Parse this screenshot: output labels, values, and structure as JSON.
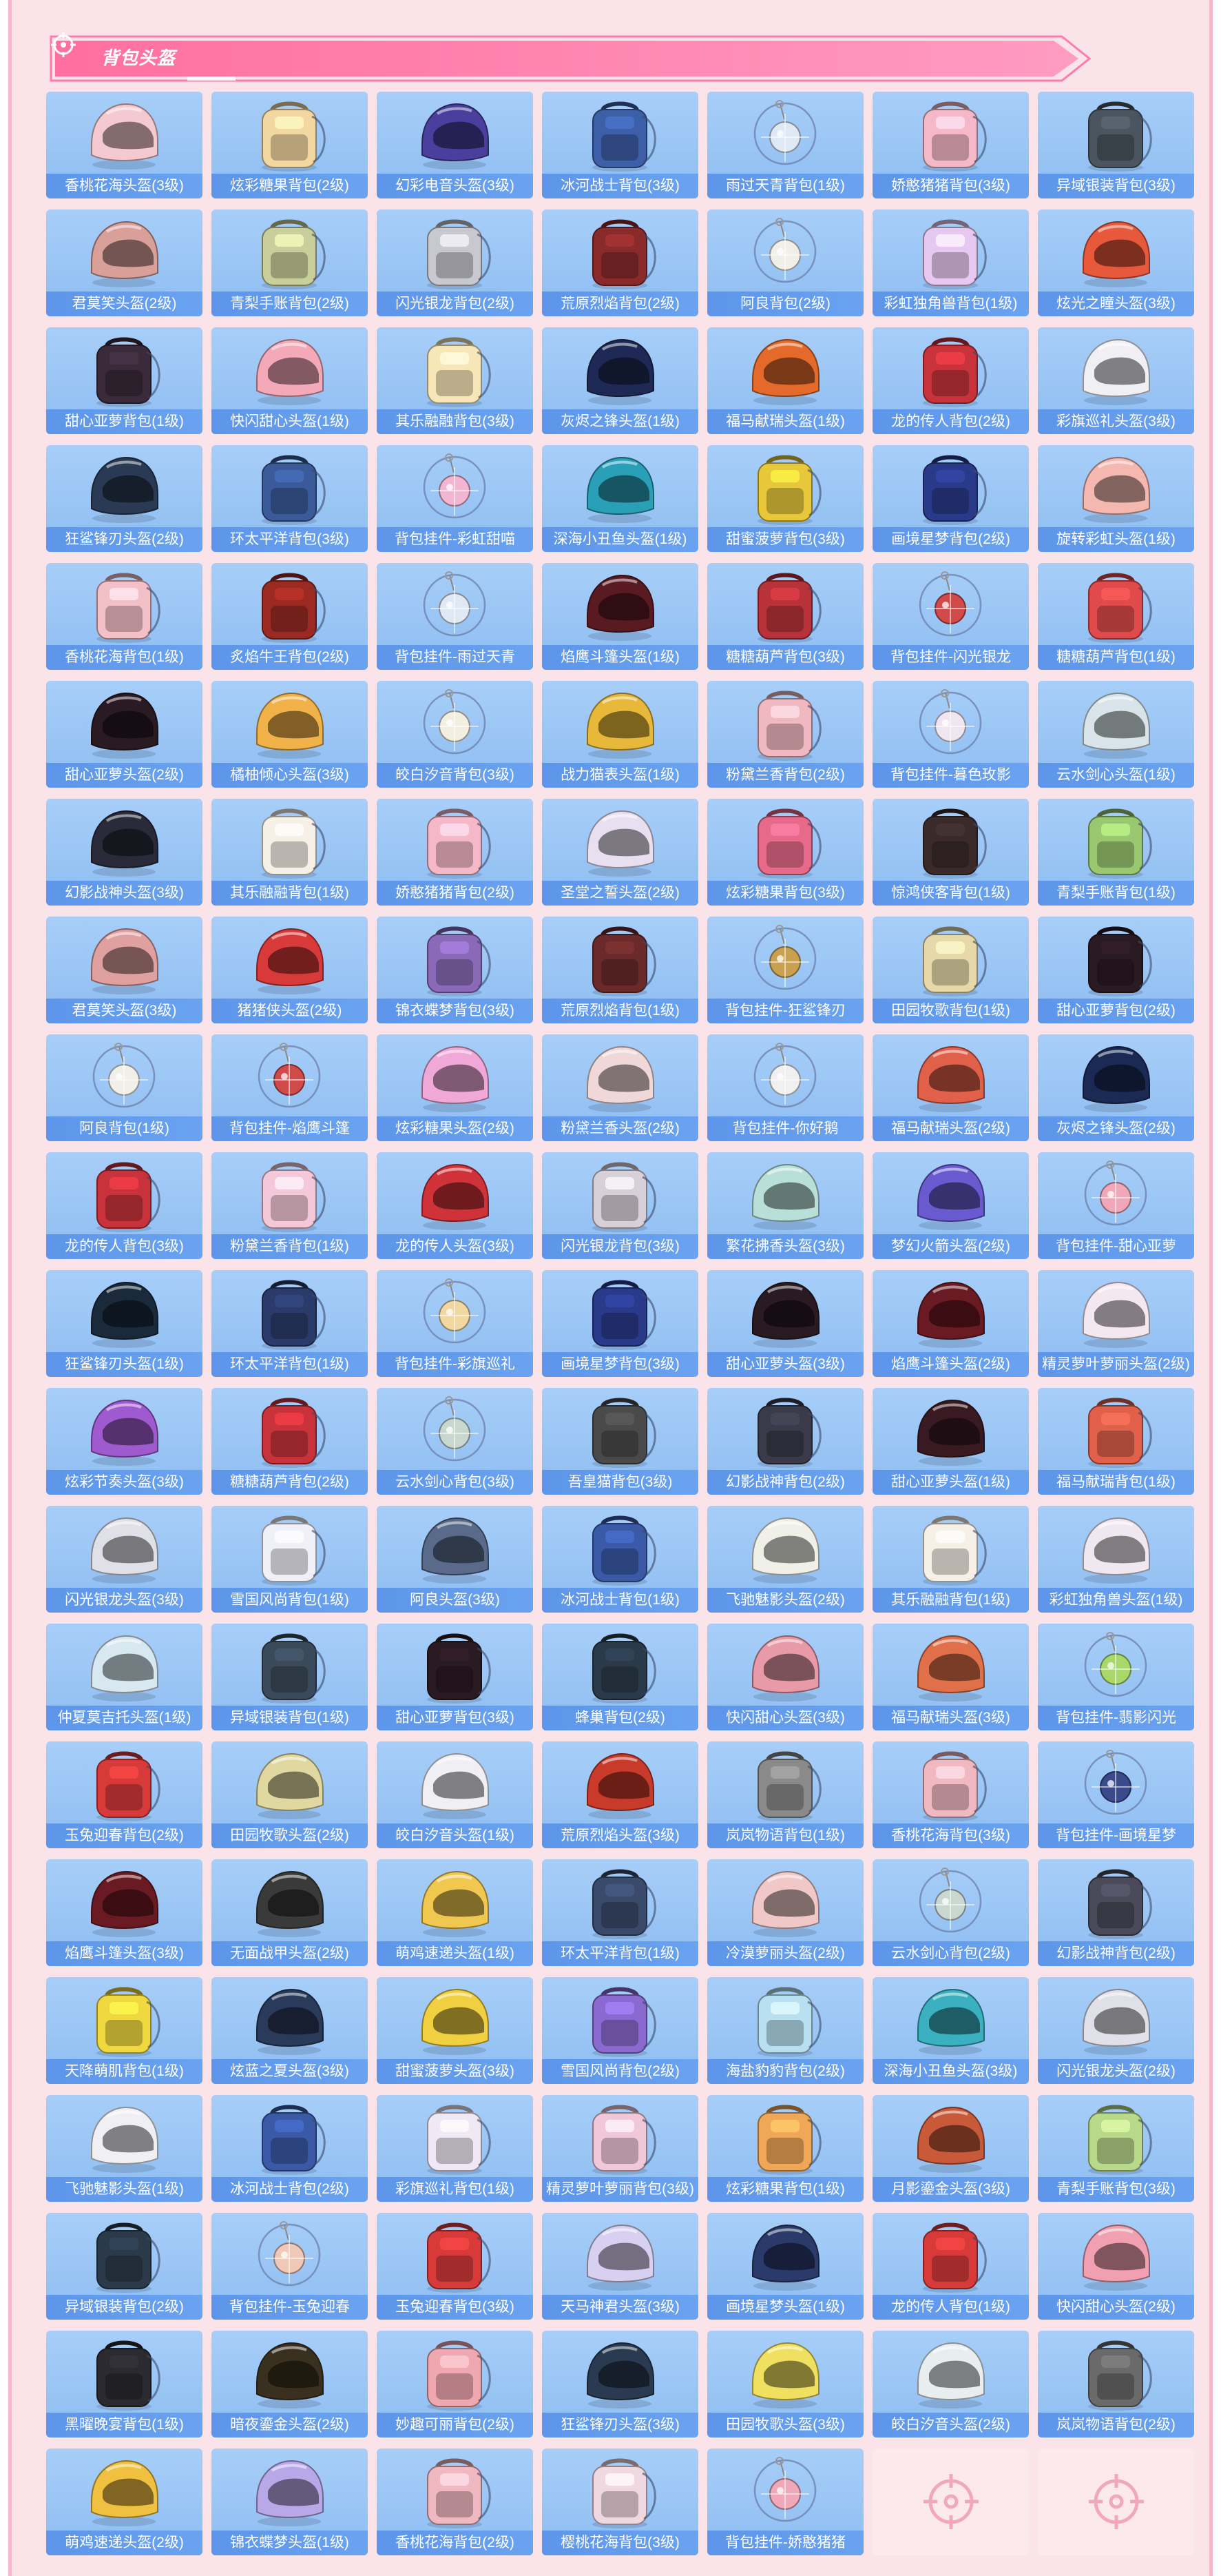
{
  "section": {
    "title": "背包头盔",
    "icon": "target-icon"
  },
  "colors": {
    "accent": "#ff7aa8",
    "tile_bg": "#9ac5f5",
    "label_bg": "#5d95ea",
    "empty_tile": "#fbe9ee",
    "panel_bg": "#fbe3ea"
  },
  "items": [
    {
      "label": "香桃花海头盔(3级)",
      "kind": "helmet",
      "color": "#f4c9cf"
    },
    {
      "label": "炫彩糖果背包(2级)",
      "kind": "backpack",
      "color": "#f2d7a0"
    },
    {
      "label": "幻彩电音头盔(3级)",
      "kind": "helmet",
      "color": "#4a3f9c"
    },
    {
      "label": "冰河战士背包(3级)",
      "kind": "backpack",
      "color": "#3d5fa8"
    },
    {
      "label": "雨过天青背包(1级)",
      "kind": "charm",
      "color": "#dfe8f5"
    },
    {
      "label": "娇憨猪猪背包(3级)",
      "kind": "backpack",
      "color": "#f4b8c8"
    },
    {
      "label": "异域银装背包(3级)",
      "kind": "backpack",
      "color": "#4b5560"
    },
    {
      "label": "君莫笑头盔(2级)",
      "kind": "helmet",
      "color": "#d9a09a"
    },
    {
      "label": "青梨手账背包(2级)",
      "kind": "backpack",
      "color": "#c9cf9a"
    },
    {
      "label": "闪光银龙背包(2级)",
      "kind": "backpack",
      "color": "#c8c8d0"
    },
    {
      "label": "荒原烈焰背包(2级)",
      "kind": "backpack",
      "color": "#8a2a2a"
    },
    {
      "label": "阿良背包(2级)",
      "kind": "charm",
      "color": "#f0efe8"
    },
    {
      "label": "彩虹独角兽背包(1级)",
      "kind": "backpack",
      "color": "#e6c8f0"
    },
    {
      "label": "炫光之瞳头盔(3级)",
      "kind": "helmet",
      "color": "#e8583a"
    },
    {
      "label": "甜心亚萝背包(1级)",
      "kind": "backpack",
      "color": "#3b2a3a"
    },
    {
      "label": "快闪甜心头盔(1级)",
      "kind": "helmet",
      "color": "#f4a9b8"
    },
    {
      "label": "其乐融融背包(3级)",
      "kind": "backpack",
      "color": "#f6e6b8"
    },
    {
      "label": "灰烬之锋头盔(1级)",
      "kind": "helmet",
      "color": "#1e2a55"
    },
    {
      "label": "福马献瑞头盔(1级)",
      "kind": "helmet",
      "color": "#e36a2a"
    },
    {
      "label": "龙的传人背包(2级)",
      "kind": "backpack",
      "color": "#c8323a"
    },
    {
      "label": "彩旗巡礼头盔(3级)",
      "kind": "helmet",
      "color": "#f0f0f4"
    },
    {
      "label": "狂鲨锋刃头盔(2级)",
      "kind": "helmet",
      "color": "#2a3a55"
    },
    {
      "label": "环太平洋背包(3级)",
      "kind": "backpack",
      "color": "#3a5a9a"
    },
    {
      "label": "背包挂件-彩虹甜喵",
      "kind": "charm",
      "color": "#f3b6d2"
    },
    {
      "label": "深海小丑鱼头盔(1级)",
      "kind": "helmet",
      "color": "#2aa0b8"
    },
    {
      "label": "甜蜜菠萝背包(3级)",
      "kind": "backpack",
      "color": "#e6c83a"
    },
    {
      "label": "画境星梦背包(2级)",
      "kind": "backpack",
      "color": "#2a3a8a"
    },
    {
      "label": "旋转彩虹头盔(1级)",
      "kind": "helmet",
      "color": "#f4b8b0"
    },
    {
      "label": "香桃花海背包(1级)",
      "kind": "backpack",
      "color": "#f4c0c8"
    },
    {
      "label": "炙焰牛王背包(2级)",
      "kind": "backpack",
      "color": "#9a2a22"
    },
    {
      "label": "背包挂件-雨过天青",
      "kind": "charm",
      "color": "#e0e8f4"
    },
    {
      "label": "焰鹰斗篷头盔(1级)",
      "kind": "helmet",
      "color": "#5a1a22"
    },
    {
      "label": "糖糖葫芦背包(3级)",
      "kind": "backpack",
      "color": "#b8323a"
    },
    {
      "label": "背包挂件-闪光银龙",
      "kind": "charm",
      "color": "#d04a4a"
    },
    {
      "label": "糖糖葫芦背包(1级)",
      "kind": "backpack",
      "color": "#e04a4a"
    },
    {
      "label": "甜心亚萝头盔(2级)",
      "kind": "helmet",
      "color": "#2a1a22"
    },
    {
      "label": "橘柚倾心头盔(3级)",
      "kind": "helmet",
      "color": "#f2b24a"
    },
    {
      "label": "皎白汐音背包(3级)",
      "kind": "charm",
      "color": "#f2efe0"
    },
    {
      "label": "战力猫表头盔(1级)",
      "kind": "helmet",
      "color": "#e8b83a"
    },
    {
      "label": "粉黛兰香背包(2级)",
      "kind": "backpack",
      "color": "#f0b8c0"
    },
    {
      "label": "背包挂件-暮色玫影",
      "kind": "charm",
      "color": "#f0e6f0"
    },
    {
      "label": "云水剑心头盔(1级)",
      "kind": "helmet",
      "color": "#d8e4ea"
    },
    {
      "label": "幻影战神头盔(3级)",
      "kind": "helmet",
      "color": "#2a2a3a"
    },
    {
      "label": "其乐融融背包(1级)",
      "kind": "backpack",
      "color": "#f6f0e6"
    },
    {
      "label": "娇憨猪猪背包(2级)",
      "kind": "backpack",
      "color": "#f4b8c8"
    },
    {
      "label": "圣堂之誓头盔(2级)",
      "kind": "helmet",
      "color": "#e8e0f0"
    },
    {
      "label": "炫彩糖果背包(3级)",
      "kind": "backpack",
      "color": "#e86a8a"
    },
    {
      "label": "惊鸿侠客背包(1级)",
      "kind": "backpack",
      "color": "#3a2a2a"
    },
    {
      "label": "青梨手账背包(1级)",
      "kind": "backpack",
      "color": "#9ac870"
    },
    {
      "label": "君莫笑头盔(3级)",
      "kind": "helmet",
      "color": "#e0a0a0"
    },
    {
      "label": "猪猪侠头盔(2级)",
      "kind": "helmet",
      "color": "#d83a3a"
    },
    {
      "label": "锦衣蝶梦背包(3级)",
      "kind": "backpack",
      "color": "#8a6ab8"
    },
    {
      "label": "荒原烈焰背包(1级)",
      "kind": "backpack",
      "color": "#6a2a2a"
    },
    {
      "label": "背包挂件-狂鲨锋刃",
      "kind": "charm",
      "color": "#c8a050"
    },
    {
      "label": "田园牧歌背包(1级)",
      "kind": "backpack",
      "color": "#e6d8a8"
    },
    {
      "label": "甜心亚萝背包(2级)",
      "kind": "backpack",
      "color": "#2a1a22"
    },
    {
      "label": "阿良背包(1级)",
      "kind": "charm",
      "color": "#f0efe8"
    },
    {
      "label": "背包挂件-焰鹰斗篷",
      "kind": "charm",
      "color": "#d04a4a"
    },
    {
      "label": "炫彩糖果头盔(2级)",
      "kind": "helmet",
      "color": "#f0a8d8"
    },
    {
      "label": "粉黛兰香头盔(2级)",
      "kind": "helmet",
      "color": "#f0d8d8"
    },
    {
      "label": "背包挂件-你好鹅",
      "kind": "charm",
      "color": "#f0f0f0"
    },
    {
      "label": "福马献瑞头盔(2级)",
      "kind": "helmet",
      "color": "#e0604a"
    },
    {
      "label": "灰烬之锋头盔(2级)",
      "kind": "helmet",
      "color": "#1a2a55"
    },
    {
      "label": "龙的传人背包(3级)",
      "kind": "backpack",
      "color": "#c8323a"
    },
    {
      "label": "粉黛兰香背包(1级)",
      "kind": "backpack",
      "color": "#f4c8d8"
    },
    {
      "label": "龙的传人头盔(3级)",
      "kind": "helmet",
      "color": "#d0323a"
    },
    {
      "label": "闪光银龙背包(3级)",
      "kind": "backpack",
      "color": "#d8d0d8"
    },
    {
      "label": "繁花拂香头盔(3级)",
      "kind": "helmet",
      "color": "#b8e0d8"
    },
    {
      "label": "梦幻火箭头盔(2级)",
      "kind": "helmet",
      "color": "#6a5ad0"
    },
    {
      "label": "背包挂件-甜心亚萝",
      "kind": "charm",
      "color": "#f0a8b8"
    },
    {
      "label": "狂鲨锋刃头盔(1级)",
      "kind": "helmet",
      "color": "#1a2a3a"
    },
    {
      "label": "环太平洋背包(1级)",
      "kind": "backpack",
      "color": "#2a3a6a"
    },
    {
      "label": "背包挂件-彩旗巡礼",
      "kind": "charm",
      "color": "#f0d8a0"
    },
    {
      "label": "画境星梦背包(3级)",
      "kind": "backpack",
      "color": "#2a3a8a"
    },
    {
      "label": "甜心亚萝头盔(3级)",
      "kind": "helmet",
      "color": "#2a1a22"
    },
    {
      "label": "焰鹰斗篷头盔(2级)",
      "kind": "helmet",
      "color": "#6a1a22"
    },
    {
      "label": "精灵萝叶萝丽头盔(2级)",
      "kind": "helmet",
      "color": "#f4e8f0"
    },
    {
      "label": "炫彩节奏头盔(3级)",
      "kind": "helmet",
      "color": "#a05ad0"
    },
    {
      "label": "糖糖葫芦背包(2级)",
      "kind": "backpack",
      "color": "#c8323a"
    },
    {
      "label": "云水剑心背包(3级)",
      "kind": "charm",
      "color": "#c8d8d0"
    },
    {
      "label": "吾皇猫背包(3级)",
      "kind": "backpack",
      "color": "#4a4a4a"
    },
    {
      "label": "幻影战神背包(2级)",
      "kind": "backpack",
      "color": "#3a3a4a"
    },
    {
      "label": "甜心亚萝头盔(1级)",
      "kind": "helmet",
      "color": "#3a1a22"
    },
    {
      "label": "福马献瑞背包(1级)",
      "kind": "backpack",
      "color": "#e0604a"
    },
    {
      "label": "闪光银龙头盔(3级)",
      "kind": "helmet",
      "color": "#e0e0e8"
    },
    {
      "label": "雪国风尚背包(1级)",
      "kind": "backpack",
      "color": "#f0f0f8"
    },
    {
      "label": "阿良头盔(3级)",
      "kind": "helmet",
      "color": "#5a6a8a"
    },
    {
      "label": "冰河战士背包(1级)",
      "kind": "backpack",
      "color": "#3a5aa8"
    },
    {
      "label": "飞驰魅影头盔(2级)",
      "kind": "helmet",
      "color": "#f0f0e8"
    },
    {
      "label": "其乐融融背包(1级)",
      "kind": "backpack",
      "color": "#f6f0e6"
    },
    {
      "label": "彩虹独角兽头盔(1级)",
      "kind": "helmet",
      "color": "#f0e8f0"
    },
    {
      "label": "仲夏莫吉托头盔(1级)",
      "kind": "helmet",
      "color": "#d8e8f0"
    },
    {
      "label": "异域银装背包(1级)",
      "kind": "backpack",
      "color": "#3a4a5a"
    },
    {
      "label": "甜心亚萝背包(3级)",
      "kind": "backpack",
      "color": "#2a1a22"
    },
    {
      "label": "蜂巢背包(2级)",
      "kind": "backpack",
      "color": "#2a3a4a"
    },
    {
      "label": "快闪甜心头盔(3级)",
      "kind": "helmet",
      "color": "#e89aa8"
    },
    {
      "label": "福马献瑞头盔(3级)",
      "kind": "helmet",
      "color": "#e0704a"
    },
    {
      "label": "背包挂件-翡影闪光",
      "kind": "charm",
      "color": "#a8d86a"
    },
    {
      "label": "玉兔迎春背包(2级)",
      "kind": "backpack",
      "color": "#d83a3a"
    },
    {
      "label": "田园牧歌头盔(2级)",
      "kind": "helmet",
      "color": "#e0d8a0"
    },
    {
      "label": "皎白汐音头盔(1级)",
      "kind": "helmet",
      "color": "#f0f0f4"
    },
    {
      "label": "荒原烈焰头盔(3级)",
      "kind": "helmet",
      "color": "#c83a2a"
    },
    {
      "label": "岚岚物语背包(1级)",
      "kind": "backpack",
      "color": "#8a8a8a"
    },
    {
      "label": "香桃花海背包(3级)",
      "kind": "backpack",
      "color": "#f0b8c0"
    },
    {
      "label": "背包挂件-画境星梦",
      "kind": "charm",
      "color": "#3a4a8a"
    },
    {
      "label": "焰鹰斗篷头盔(3级)",
      "kind": "helmet",
      "color": "#6a1a22"
    },
    {
      "label": "无面战甲头盔(2级)",
      "kind": "helmet",
      "color": "#3a3a3a"
    },
    {
      "label": "萌鸡速递头盔(1级)",
      "kind": "helmet",
      "color": "#f0c850"
    },
    {
      "label": "环太平洋背包(1级)",
      "kind": "backpack",
      "color": "#3a4a6a"
    },
    {
      "label": "冷漠萝丽头盔(2级)",
      "kind": "helmet",
      "color": "#f0c8c8"
    },
    {
      "label": "云水剑心背包(2级)",
      "kind": "charm",
      "color": "#c8d8d0"
    },
    {
      "label": "幻影战神背包(2级)",
      "kind": "backpack",
      "color": "#4a4a5a"
    },
    {
      "label": "天降萌肌背包(1级)",
      "kind": "backpack",
      "color": "#f0d840"
    },
    {
      "label": "炫蓝之夏头盔(3级)",
      "kind": "helmet",
      "color": "#2a3a5a"
    },
    {
      "label": "甜蜜菠萝头盔(3级)",
      "kind": "helmet",
      "color": "#f0d040"
    },
    {
      "label": "雪国风尚背包(2级)",
      "kind": "backpack",
      "color": "#8a6ad0"
    },
    {
      "label": "海盐豹豹背包(2级)",
      "kind": "backpack",
      "color": "#b8e0f0"
    },
    {
      "label": "深海小丑鱼头盔(3级)",
      "kind": "helmet",
      "color": "#3ab0c0"
    },
    {
      "label": "闪光银龙头盔(2级)",
      "kind": "helmet",
      "color": "#e0e0e8"
    },
    {
      "label": "飞驰魅影头盔(1级)",
      "kind": "helmet",
      "color": "#f0f0f4"
    },
    {
      "label": "冰河战士背包(2级)",
      "kind": "backpack",
      "color": "#3a5aa8"
    },
    {
      "label": "彩旗巡礼背包(1级)",
      "kind": "backpack",
      "color": "#f0e8f4"
    },
    {
      "label": "精灵萝叶萝丽背包(3级)",
      "kind": "backpack",
      "color": "#f0c8d8"
    },
    {
      "label": "炫彩糖果背包(1级)",
      "kind": "backpack",
      "color": "#f0a858"
    },
    {
      "label": "月影鎏金头盔(3级)",
      "kind": "helmet",
      "color": "#c85a3a"
    },
    {
      "label": "青梨手账背包(3级)",
      "kind": "backpack",
      "color": "#b8d88a"
    },
    {
      "label": "异域银装背包(2级)",
      "kind": "backpack",
      "color": "#2a3a4a"
    },
    {
      "label": "背包挂件-玉兔迎春",
      "kind": "charm",
      "color": "#f0c8b8"
    },
    {
      "label": "玉兔迎春背包(3级)",
      "kind": "backpack",
      "color": "#d83a3a"
    },
    {
      "label": "天马神君头盔(3级)",
      "kind": "helmet",
      "color": "#d8d0f0"
    },
    {
      "label": "画境星梦头盔(1级)",
      "kind": "helmet",
      "color": "#2a3a6a"
    },
    {
      "label": "龙的传人背包(1级)",
      "kind": "backpack",
      "color": "#d83a3a"
    },
    {
      "label": "快闪甜心头盔(2级)",
      "kind": "helmet",
      "color": "#f0a0b0"
    },
    {
      "label": "黑曜晚宴背包(1级)",
      "kind": "backpack",
      "color": "#2a2a30"
    },
    {
      "label": "暗夜鎏金头盔(2级)",
      "kind": "helmet",
      "color": "#3a3020"
    },
    {
      "label": "妙趣可丽背包(2级)",
      "kind": "backpack",
      "color": "#f0a8b0"
    },
    {
      "label": "狂鲨锋刃头盔(3级)",
      "kind": "helmet",
      "color": "#2a3a50"
    },
    {
      "label": "田园牧歌头盔(3级)",
      "kind": "helmet",
      "color": "#f0e060"
    },
    {
      "label": "皎白汐音头盔(2级)",
      "kind": "helmet",
      "color": "#e8eef0"
    },
    {
      "label": "岚岚物语背包(2级)",
      "kind": "backpack",
      "color": "#6a6a6a"
    },
    {
      "label": "萌鸡速递头盔(2级)",
      "kind": "helmet",
      "color": "#f0c040"
    },
    {
      "label": "锦衣蝶梦头盔(1级)",
      "kind": "helmet",
      "color": "#b8a8e8"
    },
    {
      "label": "香桃花海背包(2级)",
      "kind": "backpack",
      "color": "#f0b8c0"
    },
    {
      "label": "樱桃花海背包(3级)",
      "kind": "backpack",
      "color": "#f0d8e0"
    },
    {
      "label": "背包挂件-娇憨猪猪",
      "kind": "charm",
      "color": "#f0a8b8"
    },
    {
      "empty": true
    },
    {
      "empty": true
    }
  ]
}
